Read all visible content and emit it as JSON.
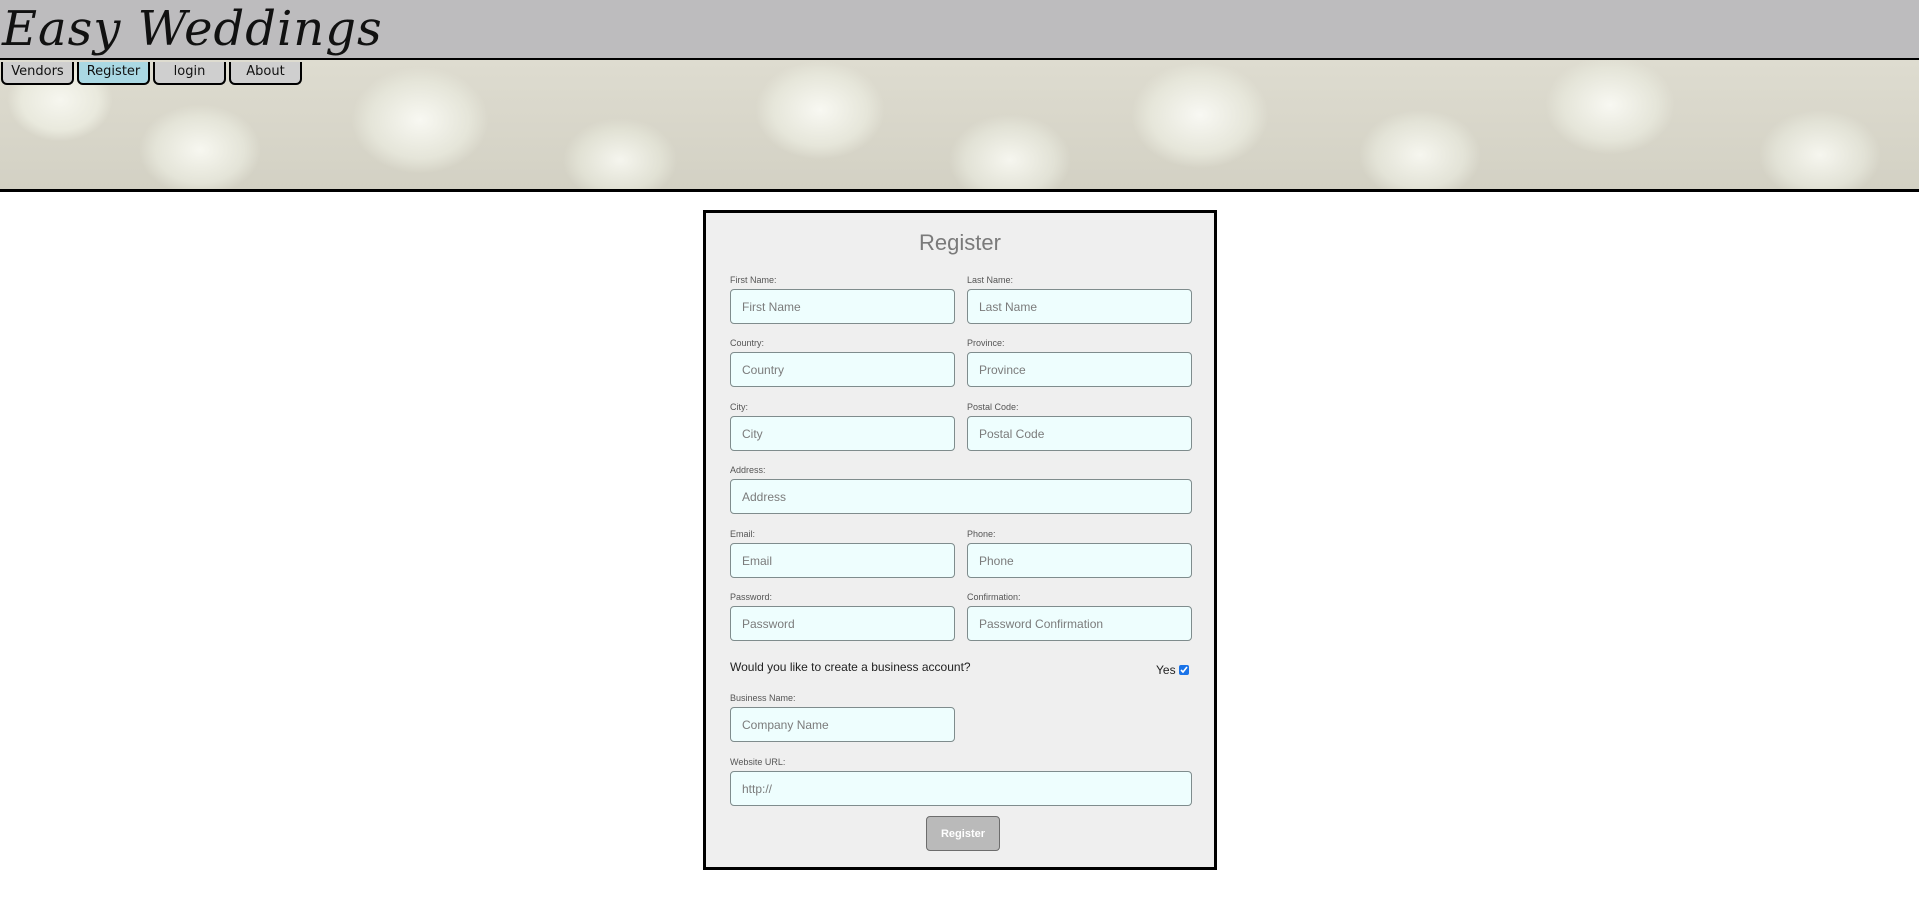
{
  "app": {
    "logo": "Easy Weddings"
  },
  "nav": {
    "items": [
      {
        "label": "Vendors",
        "active": false
      },
      {
        "label": "Register",
        "active": true
      },
      {
        "label": "login",
        "active": false
      },
      {
        "label": "About",
        "active": false
      }
    ]
  },
  "colors": {
    "topbar": "#bdbcbe",
    "nav_active": "#aad8e3",
    "nav_inactive": "#cfcfcf",
    "input_bg": "#eefefe",
    "panel_bg": "#efefef",
    "button_bg": "#bababa"
  },
  "form": {
    "title": "Register",
    "first_name": {
      "label": "First Name:",
      "placeholder": "First Name",
      "value": ""
    },
    "last_name": {
      "label": "Last Name:",
      "placeholder": "Last Name",
      "value": ""
    },
    "country": {
      "label": "Country:",
      "placeholder": "Country",
      "value": ""
    },
    "province": {
      "label": "Province:",
      "placeholder": "Province",
      "value": ""
    },
    "city": {
      "label": "City:",
      "placeholder": "City",
      "value": ""
    },
    "postal_code": {
      "label": "Postal Code:",
      "placeholder": "Postal Code",
      "value": ""
    },
    "address": {
      "label": "Address:",
      "placeholder": "Address",
      "value": ""
    },
    "email": {
      "label": "Email:",
      "placeholder": "Email",
      "value": ""
    },
    "phone": {
      "label": "Phone:",
      "placeholder": "Phone",
      "value": ""
    },
    "password": {
      "label": "Password:",
      "placeholder": "Password",
      "value": ""
    },
    "confirmation": {
      "label": "Confirmation:",
      "placeholder": "Password Confirmation",
      "value": ""
    },
    "business_question": "Would you like to create a business account?",
    "business_yes_label": "Yes",
    "business_checked": true,
    "business_name": {
      "label": "Business Name:",
      "placeholder": "Company Name",
      "value": ""
    },
    "website_url": {
      "label": "Website URL:",
      "placeholder": "http://",
      "value": ""
    },
    "submit_label": "Register"
  }
}
